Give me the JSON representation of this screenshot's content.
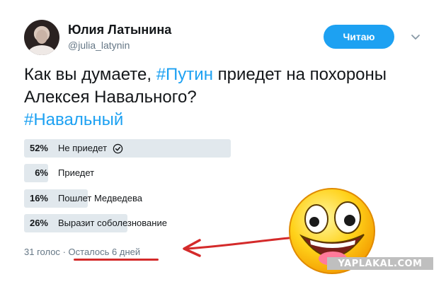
{
  "author": {
    "name": "Юлия Латынина",
    "handle": "@julia_latynin"
  },
  "follow_button": {
    "label": "Читаю"
  },
  "tweet": {
    "text_before": "Как вы думаете, ",
    "hashtag1": "#Путин",
    "text_middle": " приедет на похороны Алексея Навального?",
    "hashtag2": "#Навальный"
  },
  "poll": {
    "options": [
      {
        "percent": "52%",
        "label": "Не приедет",
        "share": 0.52,
        "selected": true
      },
      {
        "percent": "6%",
        "label": "Приедет",
        "share": 0.06,
        "selected": false
      },
      {
        "percent": "16%",
        "label": "Пошлет Медведева",
        "share": 0.16,
        "selected": false
      },
      {
        "percent": "26%",
        "label": "Выразит соболезнование",
        "share": 0.26,
        "selected": false
      }
    ],
    "votes": "31 голос",
    "separator": "·",
    "remaining": "Осталось 6 дней"
  },
  "watermark": "YAPLAKAL.COM",
  "colors": {
    "accent": "#1da1f2",
    "bar": "#e1e8ed",
    "annotation": "#d42a2a"
  },
  "icons": [
    "chevron-down-icon",
    "check-circle-icon",
    "smiley-face-icon",
    "arrow-annotation-icon"
  ]
}
